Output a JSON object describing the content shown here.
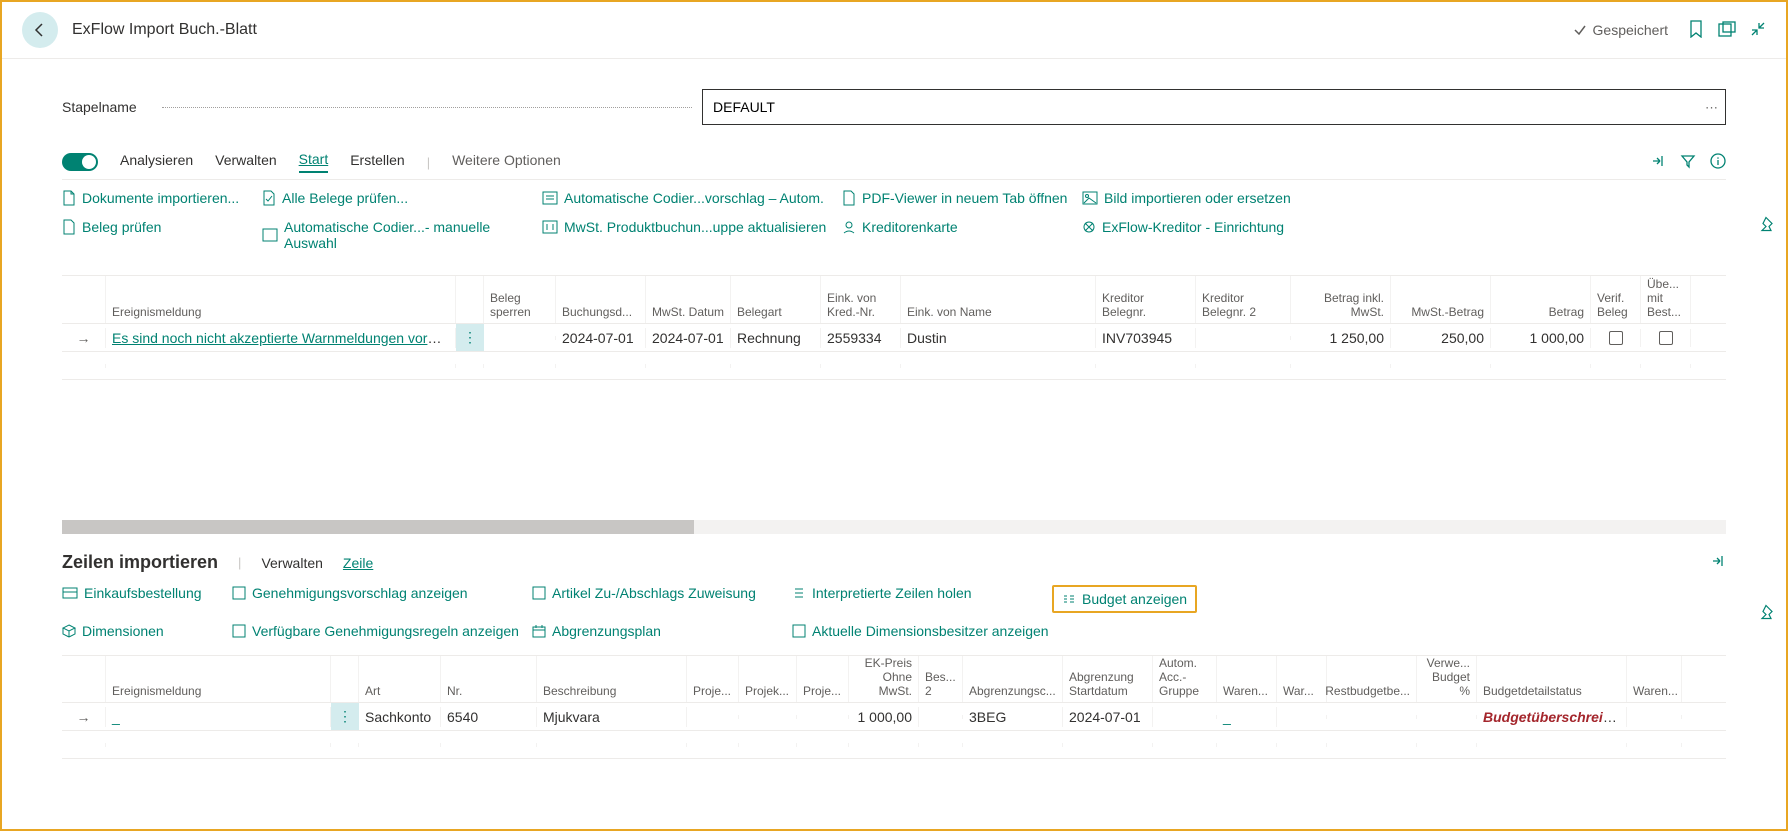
{
  "header": {
    "title": "ExFlow Import Buch.-Blatt",
    "saved": "Gespeichert"
  },
  "batch": {
    "label": "Stapelname",
    "value": "DEFAULT"
  },
  "tabs": {
    "analyse": "Analysieren",
    "manage": "Verwalten",
    "start": "Start",
    "create": "Erstellen",
    "more": "Weitere Optionen"
  },
  "toolbar": {
    "r1b1": "Dokumente importieren...",
    "r1b2": "Alle Belege prüfen...",
    "r1b3": "Automatische Codier...vorschlag – Autom.",
    "r1b4": "PDF-Viewer in neuem Tab öffnen",
    "r1b5": "Bild importieren oder ersetzen",
    "r2b1": "Beleg prüfen",
    "r2b2": "Automatische Codier...- manuelle Auswahl",
    "r2b3": "MwSt. Produktbuchun...uppe aktualisieren",
    "r2b4": "Kreditorenkarte",
    "r2b5": "ExFlow-Kreditor - Einrichtung"
  },
  "grid1": {
    "headers": {
      "event": "Ereignismeldung",
      "block": "Beleg sperren",
      "postdate": "Buchungsd...",
      "vatdate": "MwSt. Datum",
      "doctype": "Belegart",
      "vendno": "Eink. von Kred.-Nr.",
      "vendname": "Eink. von Name",
      "vendinv": "Kreditor Belegnr.",
      "vendinv2": "Kreditor Belegnr. 2",
      "amtincl": "Betrag inkl. MwSt.",
      "vatamt": "MwSt.-Betrag",
      "amount": "Betrag",
      "verif": "Verif. Beleg",
      "match": "Übe... mit Best..."
    },
    "row": {
      "event": "Es sind noch nicht akzeptierte Warnmeldungen vorhanden!",
      "postdate": "2024-07-01",
      "vatdate": "2024-07-01",
      "doctype": "Rechnung",
      "vendno": "2559334",
      "vendname": "Dustin",
      "vendinv": "INV703945",
      "amtincl": "1 250,00",
      "vatamt": "250,00",
      "amount": "1 000,00"
    }
  },
  "section2": {
    "title": "Zeilen importieren",
    "manage": "Verwalten",
    "line": "Zeile"
  },
  "subtoolbar": {
    "r1b1": "Einkaufsbestellung",
    "r1b2": "Genehmigungsvorschlag anzeigen",
    "r1b3": "Artikel Zu-/Abschlags Zuweisung",
    "r1b4": "Interpretierte Zeilen holen",
    "r1b5": "Budget anzeigen",
    "r2b1": "Dimensionen",
    "r2b2": "Verfügbare Genehmigungsregeln anzeigen",
    "r2b3": "Abgrenzungsplan",
    "r2b4": "Aktuelle Dimensionsbesitzer anzeigen"
  },
  "grid2": {
    "headers": {
      "event": "Ereignismeldung",
      "type": "Art",
      "no": "Nr.",
      "desc": "Beschreibung",
      "proj1": "Proje...",
      "proj2": "Projek...",
      "proj3": "Proje...",
      "price": "EK-Preis Ohne MwSt.",
      "bes": "Bes... 2",
      "deferral": "Abgrenzungsc...",
      "defstart": "Abgrenzung Startdatum",
      "autogroup": "Autom. Acc.- Gruppe",
      "waren1": "Waren...",
      "waren2": "War...",
      "restbudget": "Restbudgetbe...",
      "usedpct": "Verwe... Budget %",
      "status": "Budgetdetailstatus",
      "waren3": "Waren..."
    },
    "row": {
      "event": "_",
      "type": "Sachkonto",
      "no": "6540",
      "desc": "Mjukvara",
      "price": "1 000,00",
      "deferral": "3BEG",
      "defstart": "2024-07-01",
      "waren1": "_",
      "status": "Budgetüberschreitung"
    }
  }
}
